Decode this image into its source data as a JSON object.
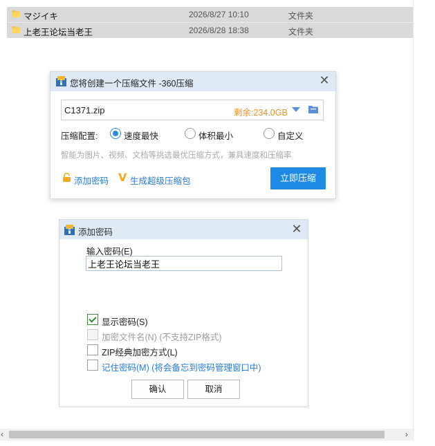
{
  "files": [
    {
      "name": "マジイキ",
      "date": "2026/8/27 10:10",
      "type": "文件夹"
    },
    {
      "name": "上老王论坛当老王",
      "date": "2026/8/28 18:38",
      "type": "文件夹"
    }
  ],
  "compress_dialog": {
    "title": "您将创建一个压缩文件 -360压缩",
    "file_name": "C1371.zip",
    "free_space": "剩余:234.0GB",
    "config_label": "压缩配置:",
    "options": [
      "速度最快",
      "体积最小",
      "自定义"
    ],
    "selected_option": "速度最快",
    "hint": "智能为图片、视频、文档等挑选最优压缩方式，兼具速度和压缩率",
    "add_password": "添加密码",
    "super_pack": "生成超级压缩包",
    "compress_now": "立即压缩"
  },
  "password_dialog": {
    "title": "添加密码",
    "input_label": "输入密码(E)",
    "password_value": "上老王论坛当老王",
    "checkboxes": [
      {
        "label": "显示密码(S)",
        "checked": true,
        "enabled": true
      },
      {
        "label": "加密文件名(N) (不支持ZIP格式)",
        "checked": false,
        "enabled": false
      },
      {
        "label": "ZIP经典加密方式(L)",
        "checked": false,
        "enabled": true
      },
      {
        "label": "记住密码(M) (将会备忘到密码管理窗口中)",
        "checked": false,
        "enabled": true
      }
    ],
    "ok": "确认",
    "cancel": "取消"
  },
  "colors": {
    "primary_button": "#1e8ae6",
    "free_space": "#e8912a",
    "link": "#2a7bd6",
    "title_bar": "#dfe9f6"
  },
  "icons": [
    "folder-icon",
    "app-icon",
    "close-icon",
    "dropdown-arrow-icon",
    "lock-icon",
    "vip-icon",
    "checkmark-icon",
    "scroll-left-icon",
    "scroll-right-icon"
  ]
}
